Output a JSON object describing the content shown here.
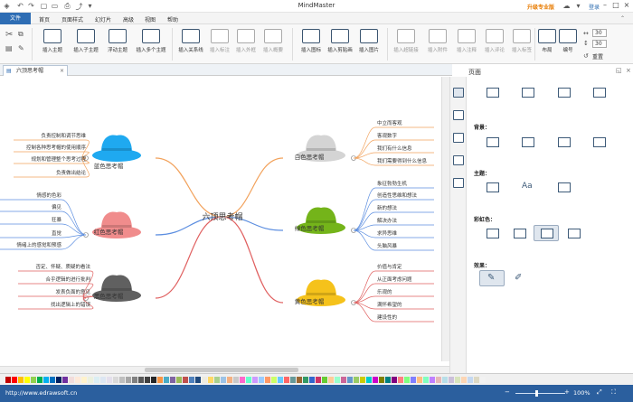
{
  "window": {
    "title": "MindMaster",
    "upgrade": "升级专业版",
    "login": "登录"
  },
  "quick_access": [
    "↶",
    "↷",
    "▢",
    "▭",
    "⎙",
    "⤴",
    "▾"
  ],
  "menu": {
    "file": "文件",
    "tabs": [
      "首页",
      "页面样式",
      "幻灯片",
      "高级",
      "视图",
      "帮助"
    ]
  },
  "ribbon": {
    "items": [
      {
        "label": "插入主题",
        "enabled": true
      },
      {
        "label": "插入子主题",
        "enabled": true
      },
      {
        "label": "浮动主题",
        "enabled": true
      },
      {
        "label": "插入多个主题",
        "enabled": true
      },
      {
        "label": "插入关系线",
        "enabled": true
      },
      {
        "label": "插入标注",
        "enabled": false
      },
      {
        "label": "插入外框",
        "enabled": false
      },
      {
        "label": "插入概要",
        "enabled": false
      },
      {
        "label": "插入图标",
        "enabled": true
      },
      {
        "label": "插入剪贴画",
        "enabled": true
      },
      {
        "label": "插入图片",
        "enabled": true
      },
      {
        "label": "插入超链接",
        "enabled": false
      },
      {
        "label": "插入附件",
        "enabled": false
      },
      {
        "label": "插入注释",
        "enabled": false
      },
      {
        "label": "插入评论",
        "enabled": false
      },
      {
        "label": "插入标签",
        "enabled": false
      },
      {
        "label": "布局",
        "enabled": true
      },
      {
        "label": "编号",
        "enabled": true
      }
    ],
    "spacing_a": "30",
    "spacing_b": "30",
    "reset": "重置"
  },
  "document": {
    "tab": "六顶思考帽"
  },
  "mindmap": {
    "central": "六顶思考帽",
    "branches": [
      {
        "name": "蓝色思考帽",
        "color": "#1fa9f0",
        "line": "#f2a25c",
        "subs": [
          "负责控制和调节思维",
          "控制各种思考帽的使用顺序",
          "规划和管理整个思考过程",
          "负责做出结论"
        ]
      },
      {
        "name": "红色思考帽",
        "color": "#f08c8c",
        "line": "#5c8ee0",
        "subs": [
          "情感的色彩",
          "偏见",
          "狂暴",
          "直觉",
          "情绪上的感觉和预感"
        ]
      },
      {
        "name": "黑色思考帽",
        "color": "#606060",
        "line": "#e06060",
        "subs": [
          "否定、怀疑、质疑的看法",
          "合乎逻辑的进行批判",
          "发表负面的意见",
          "找出逻辑上的错误"
        ]
      },
      {
        "name": "白色思考帽",
        "color": "#d4d4d4",
        "line": "#f2a25c",
        "subs": [
          "中立而客观",
          "客观数字",
          "我们有什么信息",
          "我们需要得到什么信息"
        ]
      },
      {
        "name": "绿色思考帽",
        "color": "#74b41a",
        "line": "#5c8ee0",
        "subs": [
          "象征勃勃生机",
          "创造性思维和想法",
          "新的想法",
          "解决办法",
          "求异思维",
          "头脑风暴"
        ]
      },
      {
        "name": "黄色思考帽",
        "color": "#f5c21b",
        "line": "#e06060",
        "subs": [
          "价值与肯定",
          "从正面考虑问题",
          "乐观的",
          "满怀希望的",
          "建设性的"
        ]
      }
    ]
  },
  "panel": {
    "title": "页面",
    "sections": {
      "background": "背景：",
      "theme": "主题：",
      "rainbow": "彩虹色：",
      "effect": "效果："
    }
  },
  "status": {
    "url": "http://www.edrawsoft.cn",
    "zoom": "100%"
  },
  "palette_colors": [
    "#c00000",
    "#ff0000",
    "#ffc000",
    "#ffff00",
    "#92d050",
    "#00b050",
    "#00b0f0",
    "#0070c0",
    "#002060",
    "#7030a0",
    "#f2dcdb",
    "#fde9d9",
    "#fff2cc",
    "#ebf1de",
    "#dbeef3",
    "#dce6f2",
    "#e4dfec",
    "#d9d9d9",
    "#bfbfbf",
    "#a6a6a6",
    "#808080",
    "#595959",
    "#404040",
    "#262626",
    "#f79646",
    "#4bacc6",
    "#8064a2",
    "#9bbb59",
    "#c0504d",
    "#4f81bd",
    "#1f497d",
    "#eeece1",
    "#ffd966",
    "#a9d08e",
    "#9dc3e6",
    "#f4b183",
    "#c9c9c9",
    "#ff66cc",
    "#66ffcc",
    "#cc99ff",
    "#99ccff",
    "#ff9966",
    "#ccff66",
    "#66ccff",
    "#ff6666",
    "#669999",
    "#996633",
    "#339966",
    "#3366cc",
    "#cc3366",
    "#66cc33",
    "#ffcc99",
    "#99ffcc",
    "#cc6699",
    "#6699cc",
    "#99cc66",
    "#cccc00",
    "#00cccc",
    "#cc00cc",
    "#808000",
    "#008080",
    "#800080",
    "#ff8080",
    "#80ff80",
    "#8080ff",
    "#ffbf80",
    "#80ffbf",
    "#bf80ff",
    "#e6b8b7",
    "#b7dee8",
    "#ccc0da",
    "#d8e4bc",
    "#fcd5b4",
    "#c5d9f1",
    "#ddd9c4",
    "#f2f2f2"
  ]
}
